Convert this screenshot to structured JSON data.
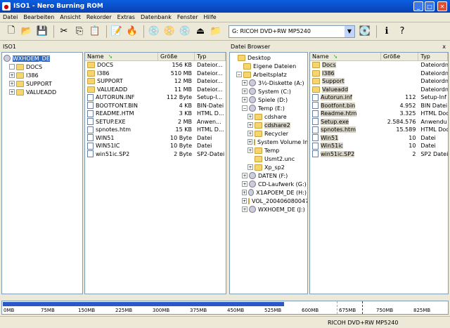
{
  "window": {
    "title": "ISO1 - Nero Burning ROM",
    "min": "_",
    "max": "□",
    "close": "✕"
  },
  "menu": [
    "Datei",
    "Bearbeiten",
    "Ansicht",
    "Rekorder",
    "Extras",
    "Datenbank",
    "Fenster",
    "Hilfe"
  ],
  "toolbar": {
    "drive": "G: RICOH    DVD+RW MP5240"
  },
  "left": {
    "header": "ISO1",
    "tree_root": "WXHOEM_DE",
    "tree": [
      "DOCS",
      "I386",
      "SUPPORT",
      "VALUEADD"
    ],
    "columns": [
      "Name",
      "Größe",
      "Typ"
    ],
    "files": [
      {
        "name": "DOCS",
        "size": "156 KB",
        "type": "Dateior..."
      },
      {
        "name": "I386",
        "size": "510 MB",
        "type": "Dateior..."
      },
      {
        "name": "SUPPORT",
        "size": "12 MB",
        "type": "Dateior..."
      },
      {
        "name": "VALUEADD",
        "size": "11 MB",
        "type": "Dateior..."
      },
      {
        "name": "AUTORUN.INF",
        "size": "112 Byte",
        "type": "Setup-I..."
      },
      {
        "name": "BOOTFONT.BIN",
        "size": "4 KB",
        "type": "BIN-Datei"
      },
      {
        "name": "README.HTM",
        "size": "3 KB",
        "type": "HTML D..."
      },
      {
        "name": "SETUP.EXE",
        "size": "2 MB",
        "type": "Anwen..."
      },
      {
        "name": "spnotes.htm",
        "size": "15 KB",
        "type": "HTML D..."
      },
      {
        "name": "WIN51",
        "size": "10 Byte",
        "type": "Datei"
      },
      {
        "name": "WIN51IC",
        "size": "10 Byte",
        "type": "Datei"
      },
      {
        "name": "win51ic.SP2",
        "size": "2 Byte",
        "type": "SP2-Datei"
      }
    ]
  },
  "right": {
    "header": "Datei Browser",
    "close": "x",
    "tree": [
      {
        "label": "Desktop",
        "indent": 0,
        "exp": ""
      },
      {
        "label": "Eigene Dateien",
        "indent": 1,
        "exp": ""
      },
      {
        "label": "Arbeitsplatz",
        "indent": 1,
        "exp": "−"
      },
      {
        "label": "3½-Diskette (A:)",
        "indent": 2,
        "exp": "+"
      },
      {
        "label": "System (C:)",
        "indent": 2,
        "exp": "+"
      },
      {
        "label": "Spiele (D:)",
        "indent": 2,
        "exp": "+"
      },
      {
        "label": "Temp (E:)",
        "indent": 2,
        "exp": "−"
      },
      {
        "label": "cdshare",
        "indent": 3,
        "exp": "+"
      },
      {
        "label": "cdshare2",
        "indent": 3,
        "exp": "+"
      },
      {
        "label": "Recycler",
        "indent": 3,
        "exp": "+"
      },
      {
        "label": "System Volume In",
        "indent": 3,
        "exp": "+"
      },
      {
        "label": "Temp",
        "indent": 3,
        "exp": "+"
      },
      {
        "label": "Usmt2.unc",
        "indent": 3,
        "exp": ""
      },
      {
        "label": "Xp_sp2",
        "indent": 3,
        "exp": "+"
      },
      {
        "label": "DATEN (F:)",
        "indent": 2,
        "exp": "+"
      },
      {
        "label": "CD-Laufwerk (G:)",
        "indent": 2,
        "exp": "+"
      },
      {
        "label": "X1APOEM_DE (H:)",
        "indent": 2,
        "exp": "+"
      },
      {
        "label": "VOL_2004060800470",
        "indent": 2,
        "exp": "+"
      },
      {
        "label": "WXHOEM_DE (J:)",
        "indent": 2,
        "exp": "+"
      }
    ],
    "columns": [
      "Name",
      "Größe",
      "Typ"
    ],
    "files": [
      {
        "name": "Docs",
        "size": "",
        "type": "Dateiordn"
      },
      {
        "name": "I386",
        "size": "",
        "type": "Dateiordn"
      },
      {
        "name": "Support",
        "size": "",
        "type": "Dateiordn"
      },
      {
        "name": "Valueadd",
        "size": "",
        "type": "Dateiordn"
      },
      {
        "name": "Autorun.inf",
        "size": "112",
        "type": "Setup-Inf"
      },
      {
        "name": "Bootfont.bin",
        "size": "4.952",
        "type": "BIN Datei"
      },
      {
        "name": "Readme.htm",
        "size": "3.325",
        "type": "HTML Doc"
      },
      {
        "name": "Setup.exe",
        "size": "2.584.576",
        "type": "Anwendu"
      },
      {
        "name": "spnotes.htm",
        "size": "15.589",
        "type": "HTML Doc"
      },
      {
        "name": "Win51",
        "size": "10",
        "type": "Datei"
      },
      {
        "name": "Win51ic",
        "size": "10",
        "type": "Datei"
      },
      {
        "name": "win51ic.SP2",
        "size": "2",
        "type": "SP2 Datei"
      }
    ]
  },
  "capacity": {
    "ticks": [
      "0MB",
      "75MB",
      "150MB",
      "225MB",
      "300MB",
      "375MB",
      "450MB",
      "525MB",
      "600MB",
      "675MB",
      "750MB",
      "825MB"
    ]
  },
  "status": {
    "drive": "RICOH    DVD+RW MP5240"
  }
}
